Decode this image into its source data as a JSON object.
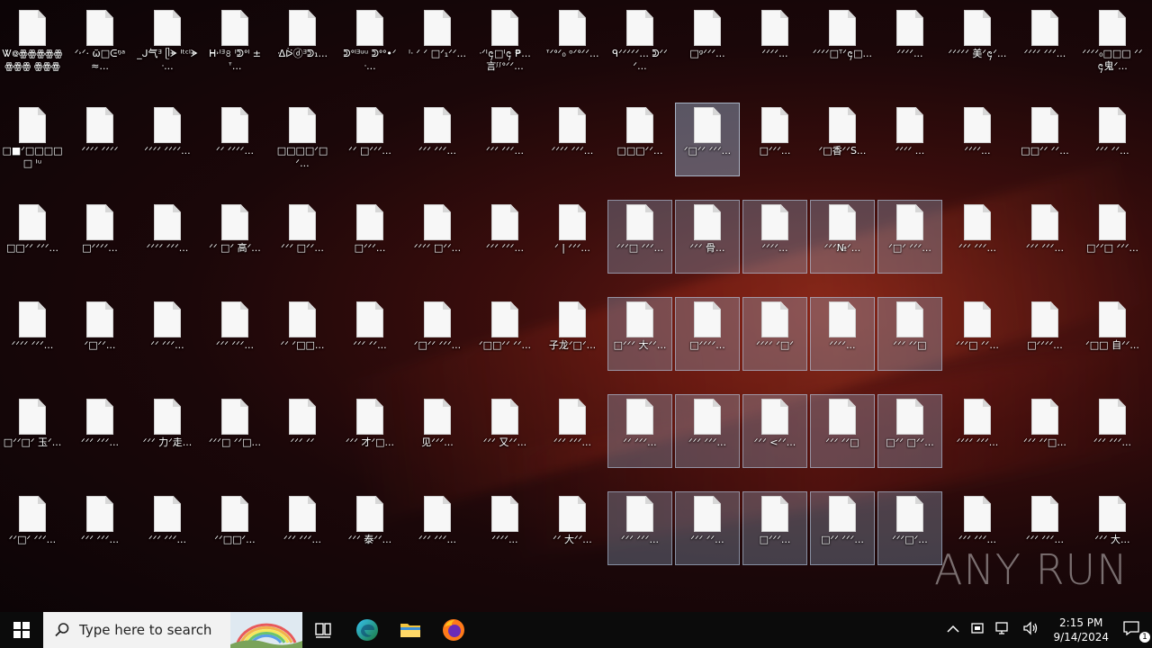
{
  "desktop": {
    "columns": 17,
    "rows": 6,
    "icons": [
      [
        "Ꮤ᪤ꙮꙮꙮꙮꙮꙮꙮꙮ ꙮꙮꙮ ꙮꙮꙮ ꙮꙮꙮ ꙮꙮꙮ ꙮꙮꙮ I₀□ᵗᵒ",
        "ᐟ˒ᐟ· ῶ□ᕮᵑᵃ≈...",
        "_ᒍ气ᴲ ᥫᗘ ᴵᵗᶜᴵᗘᐧ...",
        "ᕼ˒ᴵᴲ৪ ᴵᕲᐤᴵ ± ᐪ...",
        "ᐎᐖⓓᴲᕲ₁...",
        "ᕲᐤᴵᴲᵘᵘ ᕲᐤᐤ•ᐟᐧ...",
        "ᴵᐧ ᐟ ᐟ □ᐟ₁ᐟᐟ...",
        "ᐧᐟᴵ᪄□ᴵ᪄ ₱... 言ᶴᶴᐤᐟᐟ...",
        "ᐪᐟᐤᐟ₀ ᵒᐟᐤᐟᐟ...",
        "ᑫᐟᐟᐟᐟᐟ... ᕲᐟᐟᐟ...",
        "□ᵍᐟᐟᐟ...",
        "ᐟᐟᐟᐟ...",
        "ᐟᐟᐟᐟ□ᵀᐟ᪄□...",
        "ᐟᐟᐟᐟ...",
        "ᐟᐟᐟᐟᐟ 美ᐟ᪄ᐟ...",
        "ᐟᐟᐟᐟ ᐟᐟᐟ...",
        "ᐟᐟᐟᐟ₀□□□ ᐟᐟ᪄鬼ᐟ..."
      ],
      [
        "□■ᐟ□□□□□ ᴵᵘ",
        "ᐟᐟᐟᐟ ᐟᐟᐟᐟ",
        "ᐟᐟᐟᐟ ᐟᐟᐟᐟ...",
        "ᐟᐟ ᐟᐟᐟᐟ...",
        "□□□□ᐟ□ᐟ...",
        "ᐟᐟ □ᐟᐟᐟ...",
        "ᐟᐟᐟ ᐟᐟᐟ...",
        "ᐟᐟᐟ ᐟᐟᐟ...",
        "ᐟᐟᐟᐟ ᐟᐟᐟ...",
        "□□□ᐟᐟ...",
        "ᐟ□ᐟᐟ ᐟᐟᐟ...",
        "□ᐟᐟᐟ...",
        "ᐟ□香ᐟᐟS...",
        "ᐟᐟᐟᐟ ...",
        "ᐟᐟᐟᐟ...",
        "□□ᐟᐟ ᐟᐟ...",
        "ᐟᐟᐟ ᐟᐟ..."
      ],
      [
        "□□ᐟᐟ ᐟᐟᐟ...",
        "□ᐟᐟᐟᐟ...",
        "ᐟᐟᐟᐟ ᐟᐟᐟ...",
        "ᐟᐟ □ᐟ 高ᐟ...",
        "ᐟᐟᐟ □ᐟᐟ...",
        "□ᐟᐟᐟ...",
        "ᐟᐟᐟᐟ □ᐟᐟ...",
        "ᐟᐟᐟ ᐟᐟᐟ...",
        "ᐟ | ᐟᐟᐟ...",
        "ᐟᐟᐟ□ ᐟᐟᐟ...",
        "ᐟᐟᐟ 骨...",
        "ᐟᐟᐟᐟ...",
        "ᐟᐟᐟ№ᐟ...",
        "ᐟ□ᐟ ᐟᐟᐟ...",
        "ᐟᐟᐟ ᐟᐟᐟ...",
        "ᐟᐟᐟ ᐟᐟᐟ...",
        "□ᐟᐟ□ ᐟᐟᐟ..."
      ],
      [
        "ᐟᐟᐟᐟ ᐟᐟᐟ...",
        "ᐟ□ᐟᐟ...",
        "ᐟᐟ ᐟᐟᐟ...",
        "ᐟᐟᐟ ᐟᐟᐟ...",
        "ᐟᐟ ᐟ□□...",
        "ᐟᐟᐟ ᐟᐟ...",
        "ᐟ□ᐟᐟ ᐟᐟᐟ...",
        "ᐟ□□ᐟᐟ ᐟᐟ...",
        "子龙ᐟ□ᐟ...",
        "□ᐟᐟᐟ 大ᐟᐟ...",
        "□ᐟᐟᐟᐟ...",
        "ᐟᐟᐟᐟ ᐟ□ᐟ",
        "ᐟᐟᐟᐟ...",
        "ᐟᐟᐟ ᐟᐟ□",
        "ᐟᐟᐟ□ ᐟᐟ...",
        "□ᐟᐟᐟᐟ...",
        "ᐟ□□ 自ᐟᐟ..."
      ],
      [
        "□ᐟᐟ□ᐟ 玉ᐟ...",
        "ᐟᐟᐟ ᐟᐟᐟ...",
        "ᐟᐟᐟ 力ᐟ走...",
        "ᐟᐟᐟ□ ᐟᐟ□...",
        "ᐟᐟᐟ ᐟᐟ",
        "ᐟᐟᐟ 才ᐟ□...",
        "见ᐟᐟᐟ...",
        "ᐟᐟᐟ 又ᐟᐟ...",
        "ᐟᐟᐟ ᐟᐟᐟ...",
        "ᐟᐟ ᐟᐟᐟ...",
        "ᐟᐟᐟ ᐟᐟᐟ...",
        "ᐟᐟᐟ <ᐟᐟ...",
        "ᐟᐟᐟ ᐟᐟ□",
        "□ᐟᐟ □ᐟᐟ...",
        "ᐟᐟᐟᐟ ᐟᐟᐟ...",
        "ᐟᐟᐟ ᐟᐟ□...",
        "ᐟᐟᐟ ᐟᐟᐟ..."
      ],
      [
        "ᐟᐟ□ᐟ ᐟᐟᐟ...",
        "ᐟᐟᐟ ᐟᐟᐟ...",
        "ᐟᐟᐟ ᐟᐟᐟ...",
        "ᐟᐟ□□ᐟ...",
        "ᐟᐟᐟ ᐟᐟᐟ...",
        "ᐟᐟᐟ 泰ᐟᐟ...",
        "ᐟᐟᐟ ᐟᐟᐟ...",
        "ᐟᐟᐟᐟ...",
        "ᐟᐟ 大ᐟᐟ...",
        "ᐟᐟᐟ ᐟᐟᐟ...",
        "ᐟᐟᐟ ᐟᐟ...",
        "□ᐟᐟᐟ...",
        "□ᐟᐟ ᐟᐟᐟ...",
        "ᐟᐟᐟ□ᐟ...",
        "ᐟᐟᐟ ᐟᐟᐟ...",
        "ᐟᐟᐟ ᐟᐟᐟ...",
        "ᐟᐟᐟ 大..."
      ]
    ],
    "selected": [
      [
        1,
        10
      ],
      [
        2,
        9
      ],
      [
        2,
        10
      ],
      [
        2,
        11
      ],
      [
        2,
        12
      ],
      [
        2,
        13
      ],
      [
        3,
        9
      ],
      [
        3,
        10
      ],
      [
        3,
        11
      ],
      [
        3,
        12
      ],
      [
        3,
        13
      ],
      [
        4,
        9
      ],
      [
        4,
        10
      ],
      [
        4,
        11
      ],
      [
        4,
        12
      ],
      [
        4,
        13
      ],
      [
        5,
        9
      ],
      [
        5,
        10
      ],
      [
        5,
        11
      ],
      [
        5,
        12
      ],
      [
        5,
        13
      ]
    ],
    "focused": [
      1,
      10
    ]
  },
  "taskbar": {
    "search_placeholder": "Type here to search",
    "time": "2:15 PM",
    "date": "9/14/2024",
    "notification_count": "1"
  },
  "watermark": "ANY RUN"
}
